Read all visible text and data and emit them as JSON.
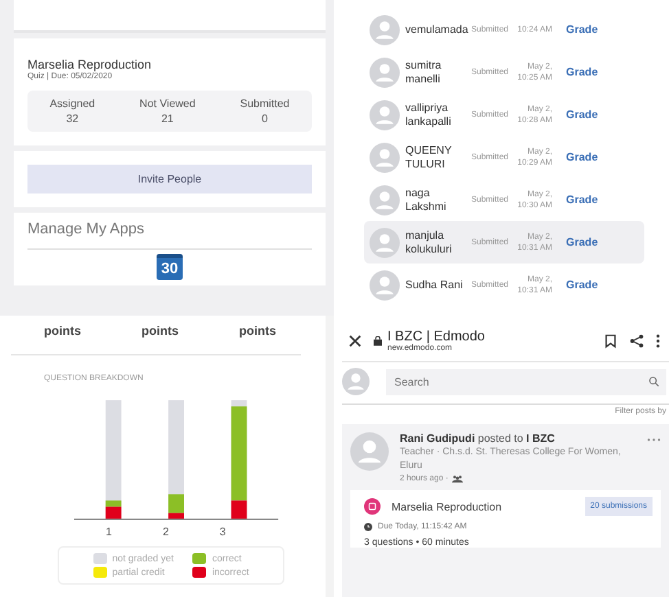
{
  "assignment_panel": {
    "title": "Marselia Reproduction",
    "subtitle": "Quiz | Due: 05/02/2020",
    "stats": [
      {
        "label": "Assigned",
        "value": "32"
      },
      {
        "label": "Not Viewed",
        "value": "21"
      },
      {
        "label": "Submitted",
        "value": "0"
      }
    ],
    "invite_button": "Invite People",
    "apps_heading": "Manage My Apps",
    "calendar_day": "30"
  },
  "submissions": [
    {
      "name": "vemulamada",
      "status": "Submitted",
      "time": "10:24 AM",
      "action": "Grade",
      "selected": false
    },
    {
      "name": "sumitra manelli",
      "status": "Submitted",
      "time": "May 2, 10:25 AM",
      "action": "Grade",
      "selected": false
    },
    {
      "name": "vallipriya lankapalli",
      "status": "Submitted",
      "time": "May 2, 10:28 AM",
      "action": "Grade",
      "selected": false
    },
    {
      "name": "QUEENY TULURI",
      "status": "Submitted",
      "time": "May 2, 10:29 AM",
      "action": "Grade",
      "selected": false
    },
    {
      "name": "naga Lakshmi",
      "status": "Submitted",
      "time": "May 2, 10:30 AM",
      "action": "Grade",
      "selected": false
    },
    {
      "name": "manjula kolukuluri",
      "status": "Submitted",
      "time": "May 2, 10:31 AM",
      "action": "Grade",
      "selected": true
    },
    {
      "name": "Sudha Rani",
      "status": "Submitted",
      "time": "May 2, 10:31 AM",
      "action": "Grade",
      "selected": false
    }
  ],
  "breakdown": {
    "points_labels": [
      "points",
      "points",
      "points"
    ],
    "heading": "QUESTION BREAKDOWN",
    "question_labels": [
      "1",
      "2",
      "3"
    ],
    "legend": [
      {
        "label": "not graded yet",
        "color": "#dcdde3"
      },
      {
        "label": "correct",
        "color": "#8cbf26"
      },
      {
        "label": "partial credit",
        "color": "#f5e90a"
      },
      {
        "label": "incorrect",
        "color": "#e0001b"
      }
    ]
  },
  "browser": {
    "title": "I BZC | Edmodo",
    "url": "new.edmodo.com",
    "search": {
      "placeholder": "Search"
    },
    "filter": "Filter posts by",
    "post": {
      "header": "**Rani Gudipudi** posted to **I BZC**",
      "role": "Teacher · Ch.s.d. St. Theresas College For Women, Eluru",
      "time": "2 hours ago ·",
      "assignment": {
        "title": "Marselia Reproduction",
        "badge": "20 submissions",
        "due": "Due Today, 11:15:42 AM",
        "details": "3 questions • 60 minutes"
      }
    }
  }
}
